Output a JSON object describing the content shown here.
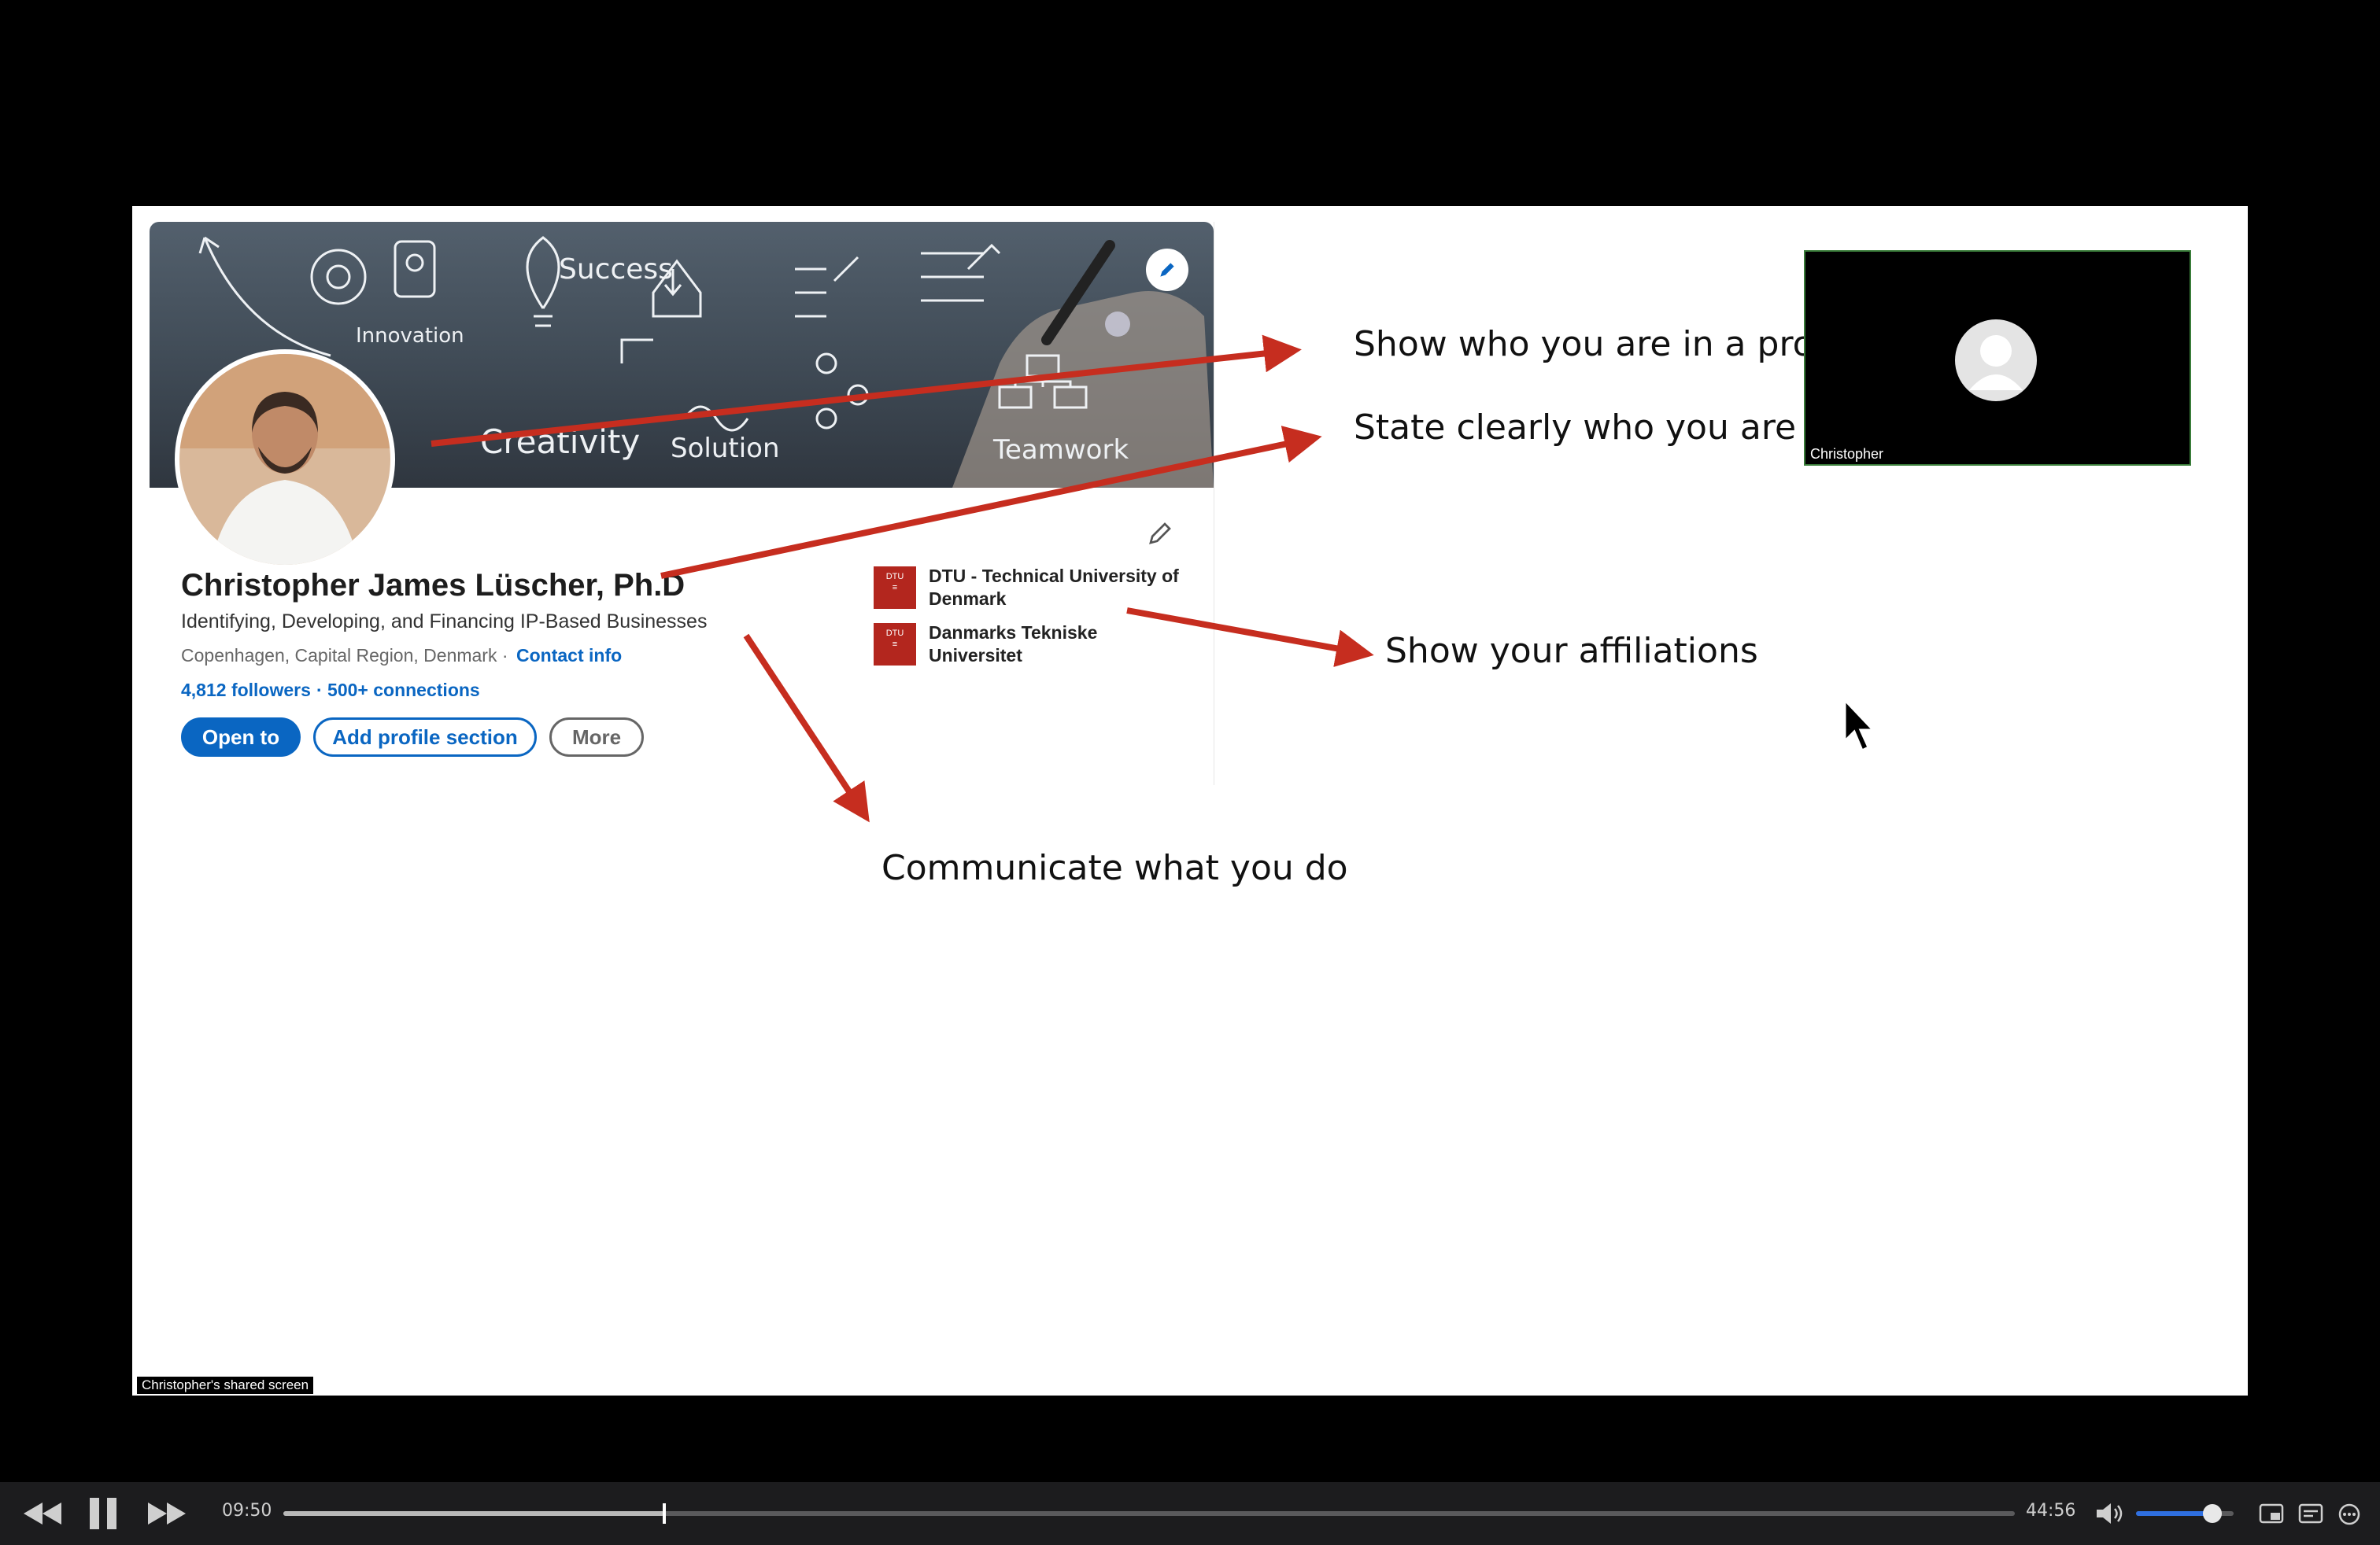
{
  "slide": {
    "shared_screen_label": "Christopher's shared screen"
  },
  "cover": {
    "doodle_words": [
      "Success",
      "Innovation",
      "Creativity",
      "Solution",
      "Teamwork"
    ]
  },
  "profile": {
    "name": "Christopher James Lüscher, Ph.D",
    "headline": "Identifying, Developing, and Financing IP-Based Businesses",
    "location": "Copenhagen, Capital Region, Denmark ·",
    "contact_link": "Contact info",
    "followers": "4,812 followers",
    "connections": "· 500+ connections",
    "buttons": {
      "open_to": "Open to",
      "add_section": "Add profile section",
      "more": "More"
    },
    "affiliations": [
      {
        "logo_text": "DTU",
        "name": "DTU - Technical University of Denmark"
      },
      {
        "logo_text": "DTU",
        "name": "Danmarks Tekniske Universitet"
      }
    ]
  },
  "annotations": {
    "show_who": "Show who you are in a profe",
    "state_clearly": "State clearly who you are",
    "affiliations": "Show your affiliations",
    "communicate": "Communicate what you do"
  },
  "video_tile": {
    "participant_name": "Christopher"
  },
  "player": {
    "current_time": "09:50",
    "total_time": "44:56",
    "progress_fraction": 0.22,
    "volume_fraction": 0.78
  },
  "colors": {
    "accent_blue": "#0a66c2",
    "arrow_red": "#c62d1f",
    "volume_blue": "#2f6fe0"
  }
}
